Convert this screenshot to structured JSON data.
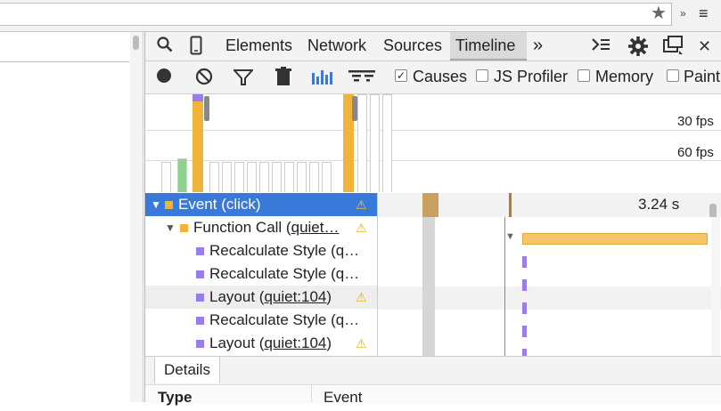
{
  "browser": {
    "star_icon": "★",
    "ext_icon": "»",
    "menu_icon": "≡"
  },
  "devtools": {
    "tabs": [
      {
        "label": "Elements"
      },
      {
        "label": "Network"
      },
      {
        "label": "Sources"
      },
      {
        "label": "Timeline"
      }
    ],
    "more_tabs": "»",
    "toolbar": {
      "causes_label": "Causes",
      "js_profiler_label": "JS Profiler",
      "memory_label": "Memory",
      "paint_label": "Paint"
    },
    "overview": {
      "fps30": "30 fps",
      "fps60": "60 fps"
    },
    "ruler": {
      "time": "3.24 s"
    },
    "tree": [
      {
        "name": "Event (click)",
        "link": "",
        "color": "#f0b43a",
        "warn": true
      },
      {
        "name": "Function Call (",
        "link": "quiet…",
        "color": "#f0b43a",
        "warn": true
      },
      {
        "name": "Recalculate Style (q…",
        "link": "",
        "color": "#9a7de8",
        "warn": false
      },
      {
        "name": "Recalculate Style (q…",
        "link": "",
        "color": "#9a7de8",
        "warn": false
      },
      {
        "name": "Layout (",
        "link": "quiet:104",
        "color": "#9a7de8",
        "warn": true
      },
      {
        "name": "Recalculate Style (q…",
        "link": "",
        "color": "#9a7de8",
        "warn": false
      },
      {
        "name": "Layout (",
        "link": "quiet:104",
        "color": "#9a7de8",
        "warn": true
      }
    ],
    "details": {
      "tab_label": "Details",
      "type_label": "Type",
      "type_value": "Event"
    }
  }
}
